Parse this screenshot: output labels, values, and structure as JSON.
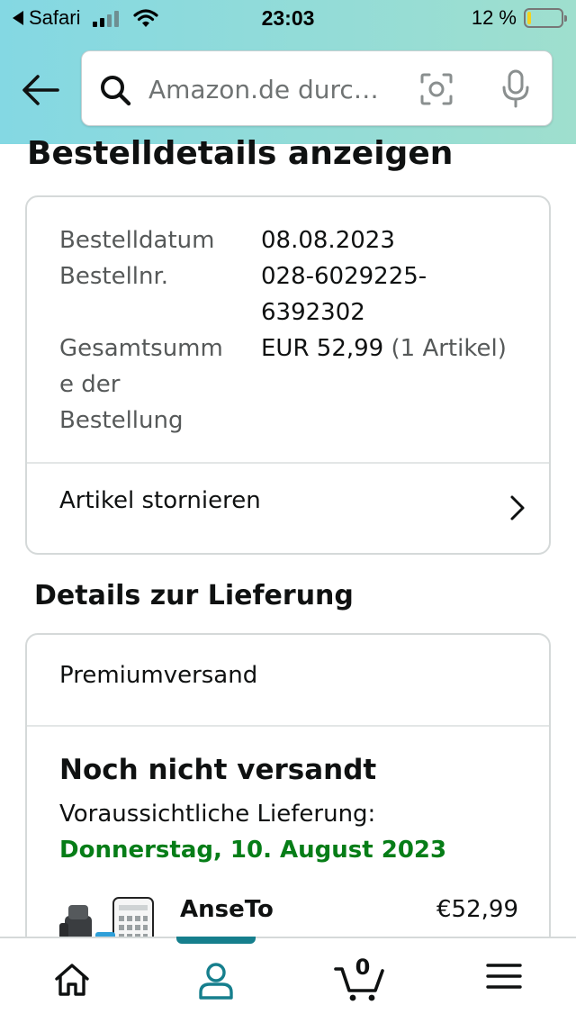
{
  "status_bar": {
    "back_app": "Safari",
    "time": "23:03",
    "battery_text": "12 %",
    "battery_level": 0.12
  },
  "search": {
    "placeholder": "Amazon.de durc…"
  },
  "page": {
    "title": "Bestelldetails anzeigen"
  },
  "order_info": {
    "date_label": "Bestelldatum",
    "date_value": "08.08.2023",
    "number_label": "Bestellnr.",
    "number_value_line1": "028-6029225-",
    "number_value_line2": "6392302",
    "total_label_line1": "Gesamtsumm",
    "total_label_line2": "e der",
    "total_label_line3": "Bestellung",
    "total_value": "EUR 52,99",
    "total_items": "(1 Artikel)",
    "cancel_label": "Artikel stornieren"
  },
  "delivery": {
    "section_title": "Details zur Lieferung",
    "ship_method": "Premiumversand",
    "status": "Noch nicht versandt",
    "eta_label": "Voraussichtliche Lieferung:",
    "eta_date": "Donnerstag, 10. August 2023",
    "product_name": "AnseTo",
    "product_price": "€52,99"
  },
  "bottom_nav": {
    "active": "account",
    "cart_count": "0",
    "active_color": "#167f8d"
  },
  "colors": {
    "header_gradient_start": "#84d8e3",
    "header_gradient_end": "#9fdfce",
    "delivery_green": "#067d17",
    "border": "#d5d9d9"
  }
}
